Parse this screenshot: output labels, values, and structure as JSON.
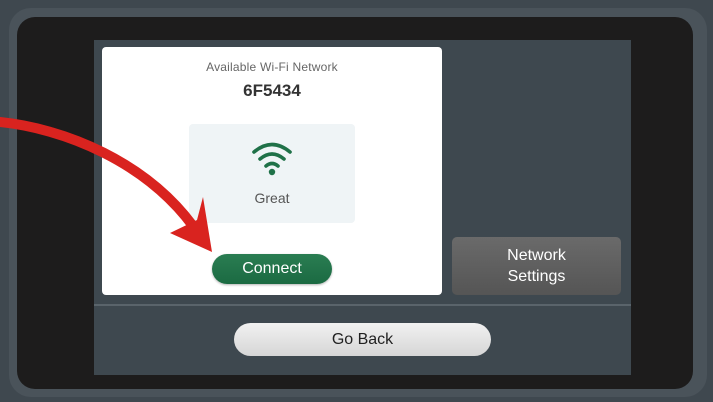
{
  "card": {
    "title": "Available Wi-Fi Network",
    "ssid": "6F5434",
    "signal_label": "Great",
    "connect_label": "Connect"
  },
  "side": {
    "network_settings_line1": "Network",
    "network_settings_line2": "Settings"
  },
  "footer": {
    "go_back_label": "Go Back"
  },
  "icons": {
    "wifi": "wifi-icon",
    "annotation": "red-arrow"
  },
  "colors": {
    "accent_green": "#1f7148",
    "annotation_red": "#d9231f",
    "screen_bg": "#3e484f"
  }
}
